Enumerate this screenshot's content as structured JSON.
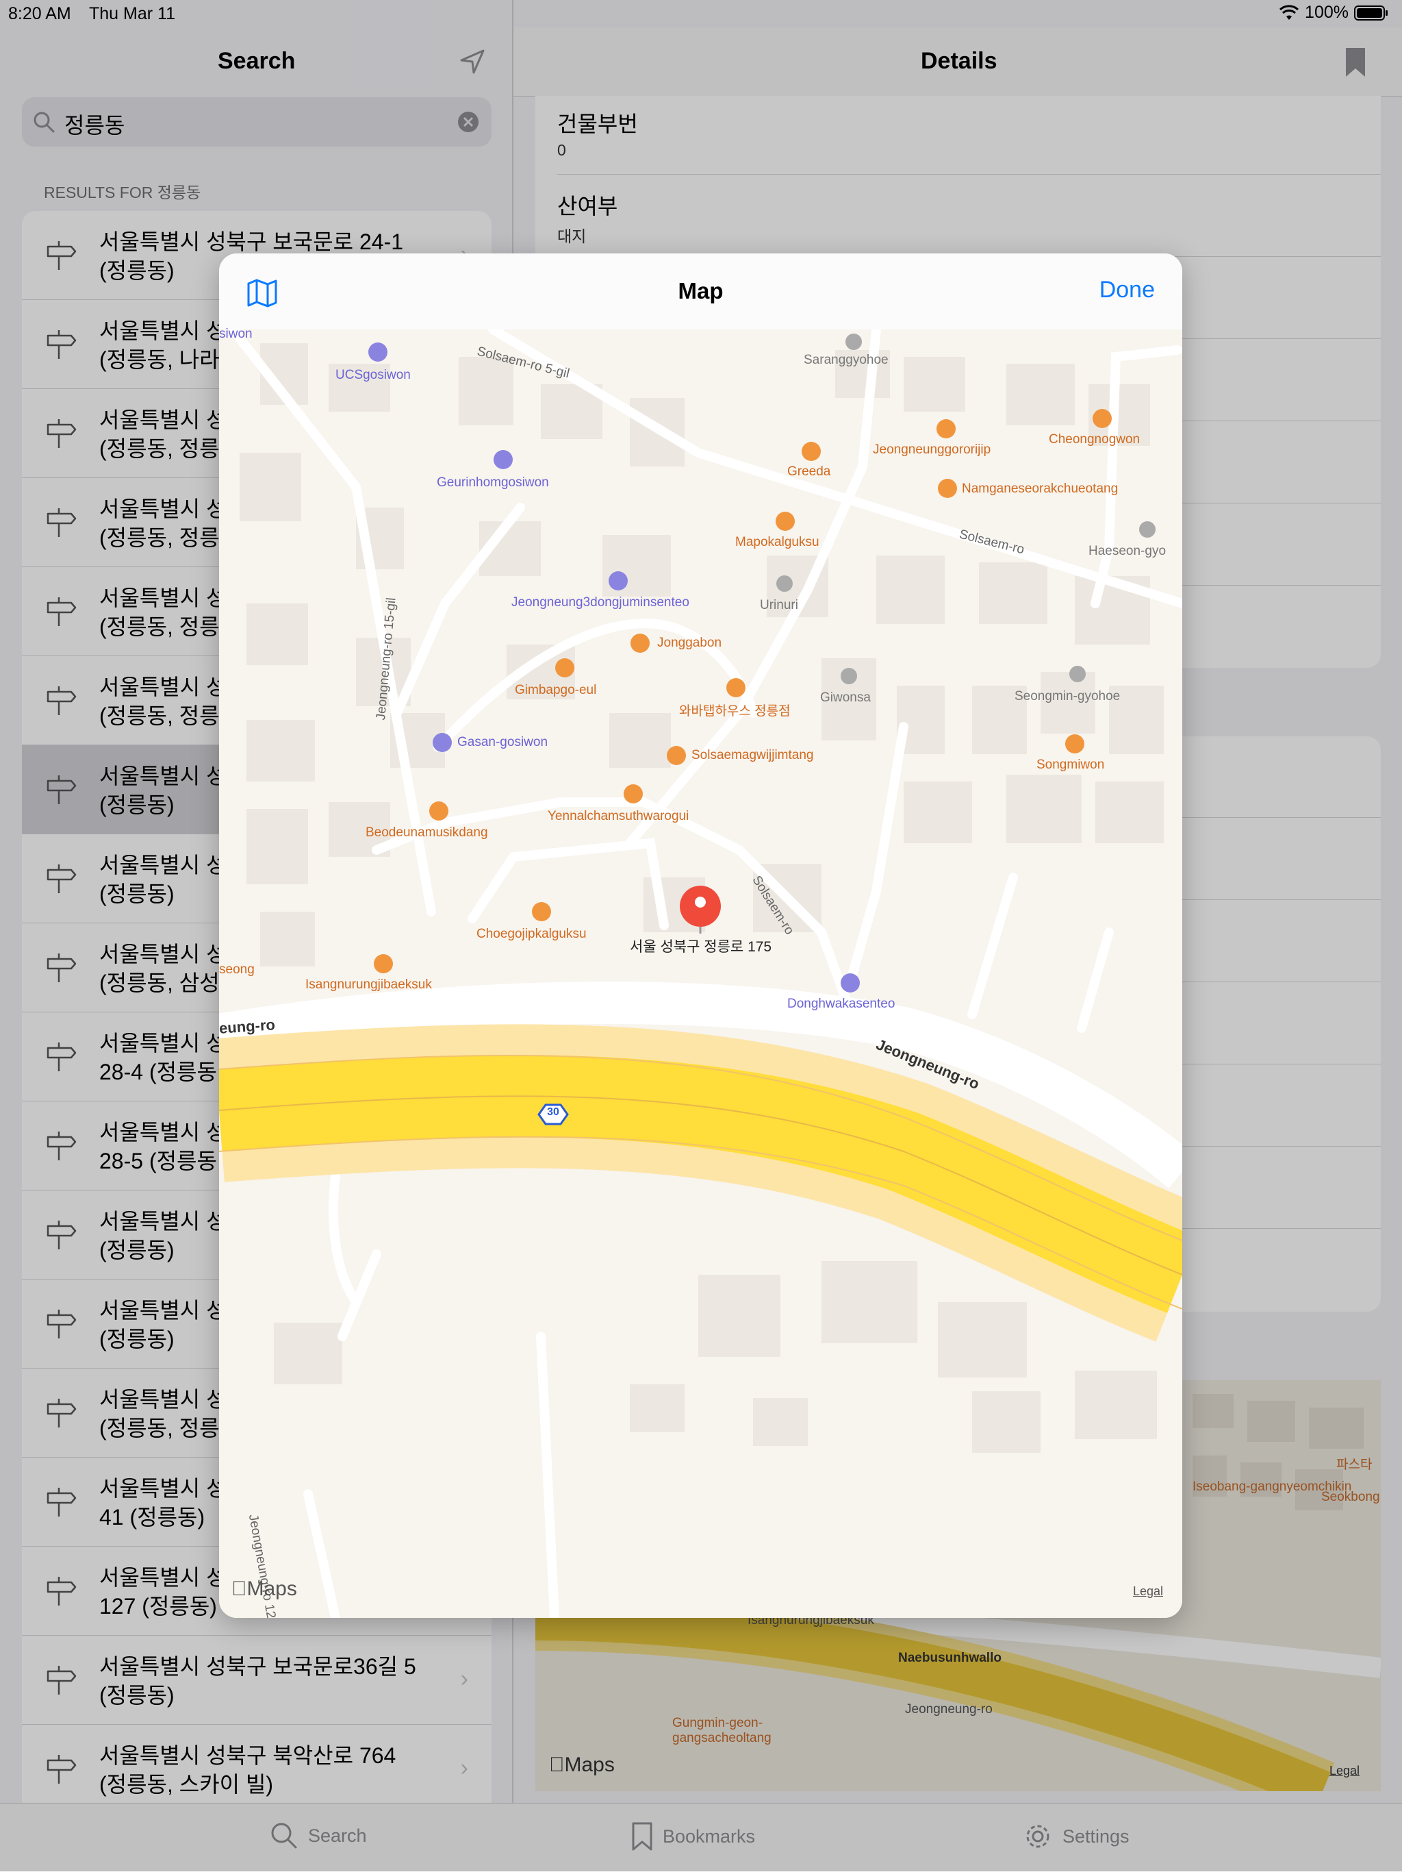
{
  "status_bar": {
    "time": "8:20 AM",
    "date": "Thu Mar 11",
    "battery": "100%"
  },
  "left_pane": {
    "title": "Search",
    "search": {
      "value": "정릉동"
    },
    "section_header": "RESULTS FOR 정릉동",
    "results": [
      {
        "line1": "서울특별시 성북구 보국문로 24-1",
        "line2": "(정릉동)"
      },
      {
        "line1": "서울특별시 성",
        "line2": "(정릉동, 나라"
      },
      {
        "line1": "서울특별시 성",
        "line2": "(정릉동, 정릉"
      },
      {
        "line1": "서울특별시 성",
        "line2": "(정릉동, 정릉"
      },
      {
        "line1": "서울특별시 성",
        "line2": "(정릉동, 정릉"
      },
      {
        "line1": "서울특별시 성",
        "line2": "(정릉동, 정릉"
      },
      {
        "line1": "서울특별시 성",
        "line2": "(정릉동)",
        "selected": true
      },
      {
        "line1": "서울특별시 성",
        "line2": "(정릉동)"
      },
      {
        "line1": "서울특별시 성",
        "line2": "(정릉동, 삼성"
      },
      {
        "line1": "서울특별시 성",
        "line2": "28-4 (정릉동"
      },
      {
        "line1": "서울특별시 성",
        "line2": "28-5 (정릉동"
      },
      {
        "line1": "서울특별시 성",
        "line2": "(정릉동)"
      },
      {
        "line1": "서울특별시 성",
        "line2": "(정릉동)"
      },
      {
        "line1": "서울특별시 성",
        "line2": "(정릉동, 정릉"
      },
      {
        "line1": "서울특별시 성",
        "line2": "41 (정릉동)"
      },
      {
        "line1": "서울특별시 성",
        "line2": "127 (정릉동)"
      },
      {
        "line1": "서울특별시 성북구 보국문로36길 5",
        "line2": "(정릉동)"
      },
      {
        "line1": "서울특별시 성북구 북악산로 764",
        "line2": "(정릉동, 스카이 빌)"
      }
    ]
  },
  "right_pane": {
    "title": "Details",
    "fields": [
      {
        "label": "건물부번",
        "value": "0"
      },
      {
        "label": "산여부",
        "value": "대지"
      }
    ],
    "minimap": {
      "logo": "Maps",
      "legal": "Legal",
      "labels": [
        "Iseobang-gangnyeomchikin",
        "Seokbong",
        "파스타",
        "Isangnurungjibaeksuk",
        "Naebusunhwallo",
        "Jeongneung-ro",
        "Gungmin-geon-gangsacheoltang"
      ]
    }
  },
  "tab_bar": {
    "search": "Search",
    "bookmarks": "Bookmarks",
    "settings": "Settings"
  },
  "modal": {
    "title": "Map",
    "done": "Done",
    "pin_label": "서울 성북구 정릉로 175",
    "highway_shield": "30",
    "logo": "Maps",
    "legal": "Legal",
    "roads": {
      "r1": "Solsaem-ro 5-gil",
      "r2": "Solsaem-ro",
      "r3": "Jeongneung-ro 15-gil",
      "r4": "Solsaem-ro",
      "r5": "Jeongneung-ro",
      "r6": "eung-ro",
      "r7": "Jeongneung-ro 12"
    },
    "pois": {
      "p1": "UCSgosiwon",
      "p2": "Saranggyohoe",
      "p3": "Geurinhomgosiwon",
      "p4": "Greeda",
      "p5": "Jeongneunggororijip",
      "p6": "Cheongnogwon",
      "p7": "Namganeseorakchueotang",
      "p8": "Mapokalguksu",
      "p9": "Haeseon-gyo",
      "p10": "Jeongneung3dongjuminsenteo",
      "p11": "Urinuri",
      "p12": "Jonggabon",
      "p13": "Gimbapgo-eul",
      "p14": "와바탭하우스 정릉점",
      "p15": "Giwonsa",
      "p16": "Seongmin-gyohoe",
      "p17": "Gasan-gosiwon",
      "p18": "Solsaemagwijjimtang",
      "p19": "Songmiwon",
      "p20": "Yennalchamsuthwarogui",
      "p21": "Beodeunamusikdang",
      "p22": "Choegojipkalguksu",
      "p23": "Isangnurungjibaeksuk",
      "p24": "Donghwakasenteo",
      "p25": "siwon",
      "p26": "seong"
    }
  }
}
